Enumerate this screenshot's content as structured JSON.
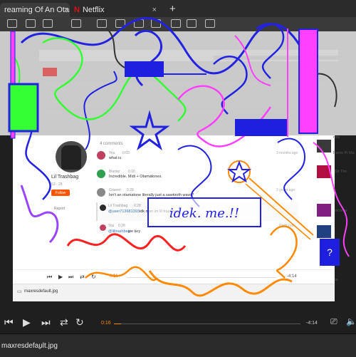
{
  "browser": {
    "tabs": [
      {
        "label": "reaming Of An Otamatone",
        "close": "×"
      },
      {
        "label": "Netflix",
        "icon": "N",
        "close": "×"
      }
    ],
    "new_tab": "+"
  },
  "profile": {
    "name": "Lil Trashbag",
    "stats": "53 · 28",
    "follow_label": "Follow",
    "report_label": "Report"
  },
  "comments": {
    "count_label": "4 comments",
    "items": [
      {
        "user": "You",
        "time": "0:03",
        "text": "what is",
        "time_ago": "3 months ago"
      },
      {
        "user": "Blunter",
        "time": "0:10",
        "text": "Incredible. Midi + Otamatones."
      },
      {
        "user": "Graeeri",
        "time": "0:28",
        "text": "Isn't an otamatone literally just a sawtooth wave?",
        "time_ago": "3 years ago"
      },
      {
        "user": "Lil Trashbag",
        "time": "0:28",
        "mention": "@user713681393",
        "text": "idk man im lil trashbag"
      },
      {
        "user": "You",
        "time": "0:28",
        "mention": "@liltrashbag",
        "text": "we key",
        "time_ago": "Right now"
      }
    ]
  },
  "sidebar": {
    "items": [
      "rmx",
      "Fame Pi Ma",
      "Sit The",
      "elcome",
      "Starchea"
    ]
  },
  "player": {
    "elapsed": "0:16",
    "remaining": "-4:14",
    "elapsed_inner": "0:16",
    "remaining_inner": "-4:14",
    "progress": 0.04
  },
  "download": {
    "file_name": "maxresdefault.jpg"
  },
  "doodle": {
    "text": "idek. me.!!"
  },
  "colors": {
    "accent": "#ff5500",
    "progress": "#ff8a00",
    "doodle_blue": "#1f1fe0",
    "doodle_magenta": "#ff40ff",
    "doodle_green": "#33ff33"
  }
}
